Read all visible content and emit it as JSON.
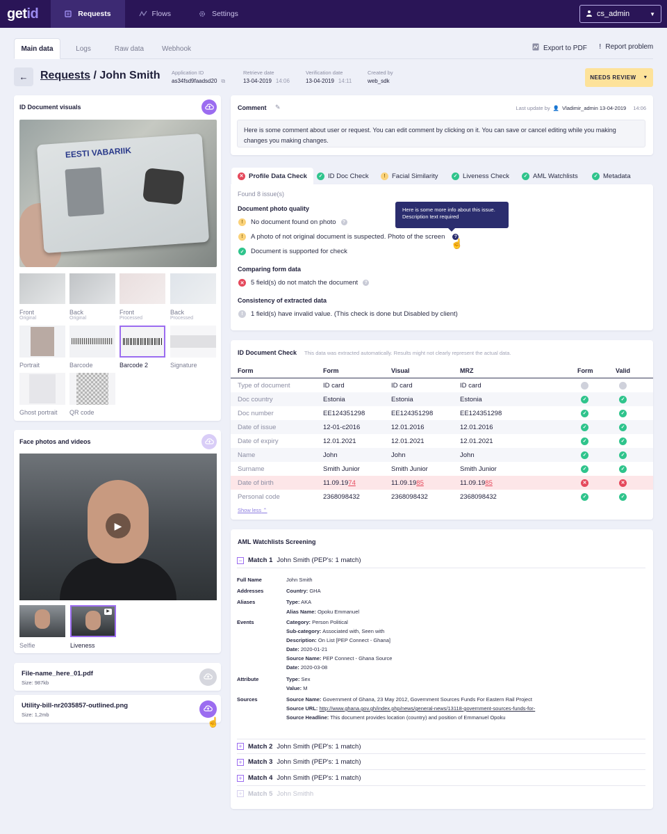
{
  "app": {
    "logo_main": "get",
    "logo_accent": "id",
    "nav": [
      {
        "label": "Requests",
        "active": true
      },
      {
        "label": "Flows",
        "active": false
      },
      {
        "label": "Settings",
        "active": false
      }
    ],
    "user": "cs_admin"
  },
  "tabs": [
    "Main data",
    "Logs",
    "Raw data",
    "Webhook"
  ],
  "actions": {
    "export": "Export to PDF",
    "report": "Report problem"
  },
  "header": {
    "crumb": "Requests",
    "separator": "/",
    "name": "John Smith",
    "meta": [
      {
        "label": "Application ID",
        "value": "as34fsd9faadsd20",
        "extra": ""
      },
      {
        "label": "Retrieve date",
        "value": "13-04-2019",
        "extra": "14:06"
      },
      {
        "label": "Verification date",
        "value": "13-04-2019",
        "extra": "14:11"
      },
      {
        "label": "Created by",
        "value": "web_sdk",
        "extra": ""
      }
    ],
    "status_button": "NEEDS REVIEW"
  },
  "id_visuals": {
    "title": "ID Document visuals",
    "card_text": "EESTI VABARIIK",
    "thumbs": [
      {
        "label": "Front",
        "sub": "Original"
      },
      {
        "label": "Back",
        "sub": "Original"
      },
      {
        "label": "Front",
        "sub": "Processed"
      },
      {
        "label": "Back",
        "sub": "Processed"
      },
      {
        "label": "Portrait",
        "sub": ""
      },
      {
        "label": "Barcode",
        "sub": ""
      },
      {
        "label": "Barcode 2",
        "sub": ""
      },
      {
        "label": "Signature",
        "sub": ""
      },
      {
        "label": "Ghost portrait",
        "sub": ""
      },
      {
        "label": "QR code",
        "sub": ""
      }
    ]
  },
  "face": {
    "title": "Face photos and videos",
    "thumbs": [
      {
        "label": "Selfie"
      },
      {
        "label": "Liveness"
      }
    ]
  },
  "files": [
    {
      "name": "File-name_here_01.pdf",
      "size": "Size: 987kb"
    },
    {
      "name": "Utility-bill-nr2035857-outlined.png",
      "size": "Size: 1,2mb"
    }
  ],
  "comment": {
    "title": "Comment",
    "last_update_label": "Last update by",
    "last_update_user": "Vladimir_admin 13-04-2019",
    "last_update_time": "14:06",
    "text": "Here is some comment about user or request. You can edit comment by clicking on it. You can save or cancel editing while you making changes you making changes."
  },
  "checks": {
    "tabs": [
      {
        "label": "Profile Data Check",
        "status": "err"
      },
      {
        "label": "ID Doc Check",
        "status": "ok"
      },
      {
        "label": "Facial Similarity",
        "status": "warn"
      },
      {
        "label": "Liveness Check",
        "status": "ok"
      },
      {
        "label": "AML Watchlists",
        "status": "ok"
      },
      {
        "label": "Metadata",
        "status": "ok"
      }
    ],
    "found": "Found 8 issue(s)",
    "sections": {
      "photo_quality": "Document photo quality",
      "form_data": "Comparing form data",
      "consistency": "Consistency of extracted data"
    },
    "issues": {
      "no_doc": "No document found on photo",
      "not_original": "A photo of not original document is suspected. Photo of the screen",
      "supported": "Document is supported for check",
      "fields_mismatch": "5 field(s) do not match the document",
      "invalid_value": "1 field(s) have invalid value. (This check is done but Disabled by client)"
    },
    "tooltip": "Here is some more info about this issue. Description text required"
  },
  "id_doc_check": {
    "title": "ID Document Check",
    "note": "This data was extracted automatically.  Results might not clearly represent the actual data.",
    "columns": [
      "Form",
      "Form",
      "Visual",
      "MRZ",
      "Form",
      "Valid"
    ],
    "rows": [
      {
        "field": "Type of document",
        "form": "ID card",
        "visual": "ID card",
        "mrz": "ID card",
        "f": "dis",
        "v": "dis"
      },
      {
        "field": "Doc country",
        "form": "Estonia",
        "visual": "Estonia",
        "mrz": "Estonia",
        "f": "ok",
        "v": "ok"
      },
      {
        "field": "Doc number",
        "form": "EE124351298",
        "visual": "EE124351298",
        "mrz": "EE124351298",
        "f": "ok",
        "v": "ok"
      },
      {
        "field": "Date of issue",
        "form": "12-01-c2016",
        "visual": "12.01.2016",
        "mrz": "12.01.2016",
        "f": "ok",
        "v": "ok"
      },
      {
        "field": "Date of expiry",
        "form": "12.01.2021",
        "visual": "12.01.2021",
        "mrz": "12.01.2021",
        "f": "ok",
        "v": "ok"
      },
      {
        "field": "Name",
        "form": "John",
        "visual": "John",
        "mrz": "John",
        "f": "ok",
        "v": "ok"
      },
      {
        "field": "Surname",
        "form": "Smith Junior",
        "visual": "Smith Junior",
        "mrz": "Smith Junior",
        "f": "ok",
        "v": "ok"
      },
      {
        "field": "Date of birth",
        "form": "11.09.19",
        "form_miss": "74",
        "visual": "11.09.19",
        "visual_miss": "85",
        "mrz": "11.09.19",
        "mrz_miss": "85",
        "f": "err",
        "v": "err"
      },
      {
        "field": "Personal code",
        "form": "2368098432",
        "visual": "2368098432",
        "mrz": "2368098432",
        "f": "ok",
        "v": "ok"
      }
    ],
    "show_less": "Show less"
  },
  "aml": {
    "title": "AML Watchlists Screening",
    "match1_label": "Match 1",
    "match1_desc": "John Smith (PEP's: 1 match)",
    "details": {
      "full_name_lbl": "Full Name",
      "full_name": "John Smith",
      "addresses_lbl": "Addresses",
      "country_k": "Country:",
      "country_v": "GHA",
      "aliases_lbl": "Aliases",
      "type_k": "Type:",
      "alias_type": "AKA",
      "alias_name_k": "Alias Name:",
      "alias_name": "Opoku Emmanuel",
      "events_lbl": "Events",
      "category_k": "Category:",
      "category": "Person Political",
      "subcat_k": "Sub-category:",
      "subcat": "Associated with, Seen with",
      "desc_k": "Description:",
      "desc": "On List [PEP Connect - Ghana]",
      "date_k": "Date:",
      "date1": "2020-01-21",
      "source_name_k": "Source Name:",
      "source_name1": "PEP Connect - Ghana Source",
      "date2": "2020-03-08",
      "attribute_lbl": "Attribute",
      "attr_type": "Sex",
      "value_k": "Value:",
      "attr_value": "M",
      "sources_lbl": "Sources",
      "source_name2": "Government of Ghana, 23 May 2012, Government Sources Funds For Eastern Rail Project",
      "source_url_k": "Source URL:",
      "source_url": "http://www.ghana.gov.gh/index.php/news/general-news/13118-government-sources-funds-for-",
      "headline_k": "Source Headline:",
      "headline": "This document provides location (country) and position of Emmanuel Opoku"
    },
    "matches": [
      {
        "label": "Match 2",
        "desc": "John Smith (PEP's: 1 match)"
      },
      {
        "label": "Match 3",
        "desc": "John Smith (PEP's: 1 match)"
      },
      {
        "label": "Match 4",
        "desc": "John Smith (PEP's: 1 match)"
      },
      {
        "label": "Match 5",
        "desc": "John Smithh"
      }
    ]
  }
}
